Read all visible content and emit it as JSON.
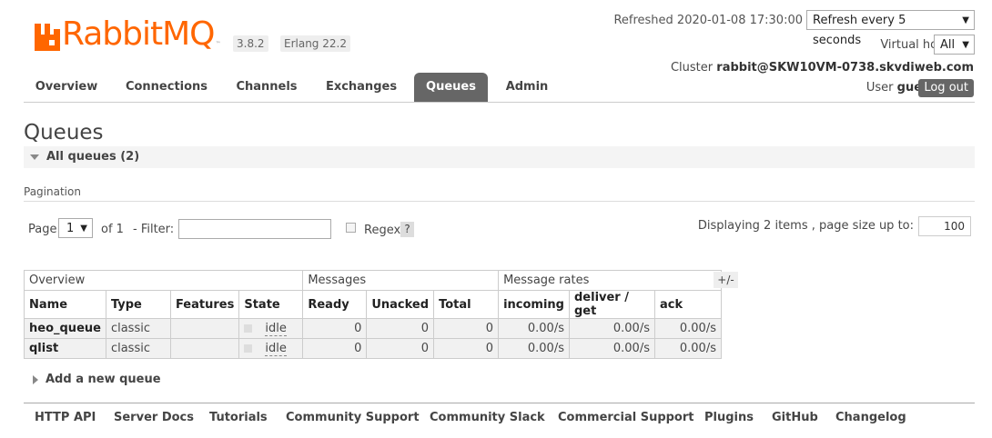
{
  "app": {
    "name": "RabbitMQ",
    "version": "3.8.2",
    "erlang": "Erlang 22.2"
  },
  "header": {
    "refreshed_text": "Refreshed 2020-01-08 17:30:00",
    "refresh_select": "Refresh every 5 seconds",
    "vhost_label": "Virtual host",
    "vhost_select": "All",
    "cluster_label": "Cluster",
    "cluster_name": "rabbit@SKW10VM-0738.skvdiweb.com",
    "user_label": "User",
    "user_name": "guest",
    "logout_label": "Log out"
  },
  "tabs": [
    {
      "label": "Overview"
    },
    {
      "label": "Connections"
    },
    {
      "label": "Channels"
    },
    {
      "label": "Exchanges"
    },
    {
      "label": "Queues",
      "active": true
    },
    {
      "label": "Admin"
    }
  ],
  "page": {
    "title": "Queues",
    "section_label": "All queues (2)",
    "pagination_heading": "Pagination",
    "page_label": "Page",
    "page_value": "1",
    "of_label": "of 1",
    "filter_label": "- Filter:",
    "filter_value": "",
    "regex_label": "Regex",
    "help_label": "?",
    "displaying_text": "Displaying 2 items , page size up to:",
    "page_size": "100",
    "plusminus": "+/-",
    "add_queue_label": "Add a new queue"
  },
  "table": {
    "groups": [
      "Overview",
      "Messages",
      "Message rates"
    ],
    "columns": [
      "Name",
      "Type",
      "Features",
      "State",
      "Ready",
      "Unacked",
      "Total",
      "incoming",
      "deliver / get",
      "ack"
    ],
    "rows": [
      {
        "name": "heo_queue",
        "type": "classic",
        "features": "",
        "state": "idle",
        "ready": "0",
        "unacked": "0",
        "total": "0",
        "incoming": "0.00/s",
        "deliver": "0.00/s",
        "ack": "0.00/s"
      },
      {
        "name": "qlist",
        "type": "classic",
        "features": "",
        "state": "idle",
        "ready": "0",
        "unacked": "0",
        "total": "0",
        "incoming": "0.00/s",
        "deliver": "0.00/s",
        "ack": "0.00/s"
      }
    ]
  },
  "footer": [
    "HTTP API",
    "Server Docs",
    "Tutorials",
    "Community Support",
    "Community Slack",
    "Commercial Support",
    "Plugins",
    "GitHub",
    "Changelog"
  ],
  "colors": {
    "brand": "#ff6600",
    "active_tab": "#666666"
  }
}
